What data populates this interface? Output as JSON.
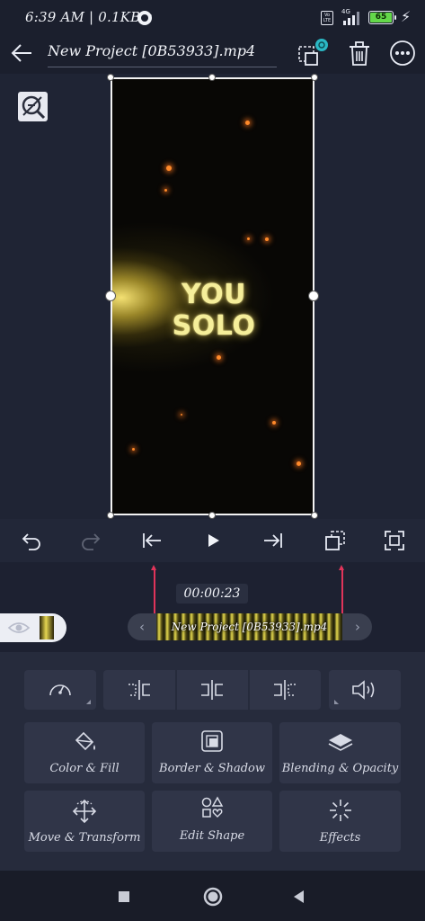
{
  "status_bar": {
    "time": "6:39 AM | 0.1KB/s",
    "network": "4G",
    "volte": "Vo LTE",
    "battery": "65"
  },
  "app_bar": {
    "title": "New Project [0B53933].mp4"
  },
  "preview": {
    "caption": "YOU SOLO"
  },
  "timeline": {
    "timecode": "00:00:23",
    "clip_label": "New Project [0B53933].mp4"
  },
  "edit_panel": {
    "tiles": [
      {
        "label": "Color & Fill"
      },
      {
        "label": "Border & Shadow"
      },
      {
        "label": "Blending & Opacity"
      },
      {
        "label": "Move & Transform"
      },
      {
        "label": "Edit Shape"
      },
      {
        "label": "Effects"
      }
    ]
  },
  "colors": {
    "accent": "#e0345a",
    "background": "#1c2030",
    "panel": "#262b3c",
    "tile": "#303548",
    "battery": "#64d84a"
  }
}
